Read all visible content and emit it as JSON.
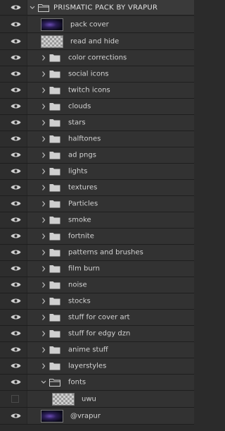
{
  "layers_panel": {
    "group": {
      "name": "PRISMATIC PACK BY VRAPUR",
      "expanded": true,
      "visible": true
    },
    "items": [
      {
        "name": "pack cover",
        "kind": "image-layer",
        "thumbnail": "dark-purple",
        "visible": true
      },
      {
        "name": "read and hide",
        "kind": "image-layer",
        "thumbnail": "transparent-checker",
        "visible": true
      },
      {
        "name": "color corrections",
        "kind": "folder",
        "visible": true,
        "expanded": false
      },
      {
        "name": "social icons",
        "kind": "folder",
        "visible": true,
        "expanded": false
      },
      {
        "name": "twitch icons",
        "kind": "folder",
        "visible": true,
        "expanded": false
      },
      {
        "name": "clouds",
        "kind": "folder",
        "visible": true,
        "expanded": false
      },
      {
        "name": "stars",
        "kind": "folder",
        "visible": true,
        "expanded": false
      },
      {
        "name": "halftones",
        "kind": "folder",
        "visible": true,
        "expanded": false
      },
      {
        "name": "ad pngs",
        "kind": "folder",
        "visible": true,
        "expanded": false
      },
      {
        "name": "lights",
        "kind": "folder",
        "visible": true,
        "expanded": false
      },
      {
        "name": "textures",
        "kind": "folder",
        "visible": true,
        "expanded": false
      },
      {
        "name": "Particles",
        "kind": "folder",
        "visible": true,
        "expanded": false
      },
      {
        "name": "smoke",
        "kind": "folder",
        "visible": true,
        "expanded": false
      },
      {
        "name": "fortnite",
        "kind": "folder",
        "visible": true,
        "expanded": false
      },
      {
        "name": "patterns and brushes",
        "kind": "folder",
        "visible": true,
        "expanded": false
      },
      {
        "name": "film burn",
        "kind": "folder",
        "visible": true,
        "expanded": false
      },
      {
        "name": "noise",
        "kind": "folder",
        "visible": true,
        "expanded": false
      },
      {
        "name": "stocks",
        "kind": "folder",
        "visible": true,
        "expanded": false
      },
      {
        "name": "stuff for cover art",
        "kind": "folder",
        "visible": true,
        "expanded": false
      },
      {
        "name": "stuff for edgy dzn",
        "kind": "folder",
        "visible": true,
        "expanded": false
      },
      {
        "name": "anime stuff",
        "kind": "folder",
        "visible": true,
        "expanded": false
      },
      {
        "name": "layerstyles",
        "kind": "folder",
        "visible": true,
        "expanded": false
      },
      {
        "name": "fonts",
        "kind": "folder",
        "visible": true,
        "expanded": true
      },
      {
        "name": "uwu",
        "kind": "image-layer",
        "thumbnail": "transparent-checker",
        "visible": false
      }
    ],
    "bottom_layer": {
      "name": "@vrapur",
      "kind": "image-layer",
      "thumbnail": "dark-purple",
      "visible": true
    }
  },
  "colors": {
    "panel_bg": "#323232",
    "text": "#d4d4d4",
    "icon": "#cfcfcf"
  }
}
